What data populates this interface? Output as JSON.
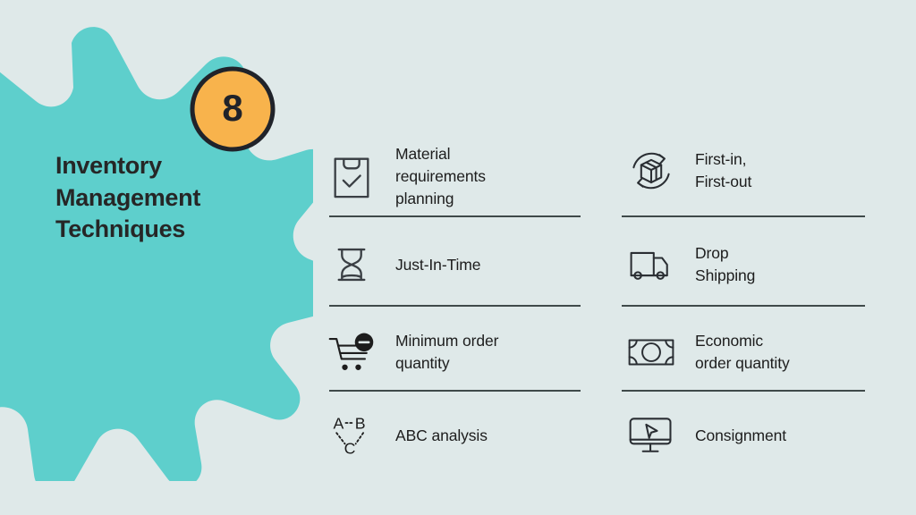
{
  "theme": {
    "background": "#dfe9e9",
    "accent_teal": "#5ecfcc",
    "accent_orange": "#f8b34c",
    "ink": "#262626",
    "divider": "#3f4a4a"
  },
  "hero": {
    "badge_number": "8",
    "title": "Inventory\nManagement\nTechniques"
  },
  "techniques": {
    "left_column": [
      {
        "icon": "clipboard-check-icon",
        "label": "Material\nrequirements\nplanning"
      },
      {
        "icon": "hourglass-icon",
        "label": "Just-In-Time"
      },
      {
        "icon": "cart-minus-icon",
        "label": "Minimum order\nquantity"
      },
      {
        "icon": "abc-nodes-icon",
        "label": "ABC analysis"
      }
    ],
    "right_column": [
      {
        "icon": "box-rotation-icon",
        "label": "First-in,\nFirst-out"
      },
      {
        "icon": "delivery-truck-icon",
        "label": "Drop\nShipping"
      },
      {
        "icon": "banknote-icon",
        "label": "Economic\norder quantity"
      },
      {
        "icon": "monitor-cursor-icon",
        "label": "Consignment"
      }
    ]
  }
}
